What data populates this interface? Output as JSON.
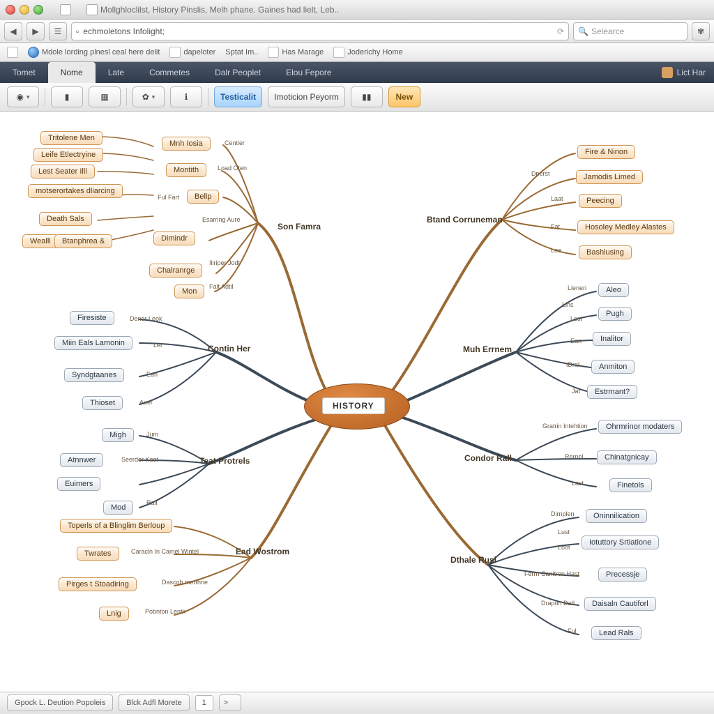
{
  "window": {
    "title": "Mollghloclilst, History Pinslis, Melh phane. Gaines had lielt, Leb.."
  },
  "browser": {
    "url": "echmoletons Infolight;",
    "search_placeholder": "Selearce",
    "bookmarks": [
      {
        "label": "Mdole lording plnesl ceal here delit"
      },
      {
        "label": "dapeloter"
      },
      {
        "label": "Sptat Im.."
      },
      {
        "label": "Has Marage"
      },
      {
        "label": "Joderichy Home"
      }
    ]
  },
  "appnav": {
    "items": [
      "Tomet",
      "Nome",
      "Late",
      "Commetes",
      "Dalr Peoplet",
      "Elou Fepore"
    ],
    "active": 1,
    "user": "Lict Har"
  },
  "toolbar": {
    "tab_blue": "Testicalit",
    "tab_plain": "Imoticion Peyorm",
    "tab_new": "New"
  },
  "center": "HISTORY",
  "branches": {
    "bl1": "Son Famra",
    "bl2": "Contin Her",
    "bl3": "Teat Protrels",
    "bl4": "Ead Wostrom",
    "br1": "Btand Corruneman",
    "br2": "Muh Errnem",
    "br3": "Condor Rall",
    "br4": "Dthale Rusl"
  },
  "nodes": {
    "tl_a": "Tritolene Men",
    "tl_b": "Leife Etlectryine",
    "tl_c": "Lest Seater Illl",
    "tl_d": "motserortakes dliarcing",
    "tl_e": "Death Sals",
    "tl_f": "Wealll",
    "tl_g": "Btanphrea &",
    "o1": "Mnh Iosia",
    "o2": "Montith",
    "o3": "Bellp",
    "o4": "Dimindr",
    "o5": "Chalranrge",
    "o6": "Mon",
    "g1": "Firesiste",
    "g2": "Miin Eals Lamonin",
    "g3": "Syndgtaanes",
    "g4": "Thioset",
    "g5": "Migh",
    "g6": "Atnnwer",
    "g7": "Euimers",
    "g8": "Mod",
    "o7": "Toperls of a Blinglim Berloup",
    "o8": "Twrates",
    "o9": "Pirges t Stoadiring",
    "o10": "Lnig",
    "r1": "Fire & Ninon",
    "r2": "Jamodis Limed",
    "r3": "Peecing",
    "r4": "Hosoley Medley Alastes",
    "r5": "Bashlusing",
    "rg1": "Aleo",
    "rg2": "Pugh",
    "rg3": "Inalitor",
    "rg4": "Anmiton",
    "rg5": "Estrmant?",
    "rg6": "Ohrmrinor modaters",
    "rg7": "Chinatgnicay",
    "rg8": "Finetols",
    "rg9": "Oninnilication",
    "rg10": "Iotuttory Srtiatione",
    "rg11": "Precessje",
    "rg12": "Daisaln Cautiforl",
    "rg13": "Lead Rals"
  },
  "mini": {
    "m1": "Centier",
    "m2": "Load Oten",
    "m3": "Ful  Fart",
    "m4": "Esarring  Aure",
    "m5": "Iliriper Jodt",
    "m6": "Falt  Adtil",
    "m7": "Denor Leok",
    "m8": "Let",
    "m9": "Ean",
    "m10": "Auel",
    "m11": "Jum",
    "m12": "Seerder Kaot",
    "m13": "Rall",
    "m14": "Caracln In Camel Wintel",
    "m15": "Dascob merthne",
    "m16": "Pobnton Lentk",
    "m17": "Dperst",
    "m18": "Laat",
    "m19": "Fat",
    "m20": "Lee",
    "m21": "Lienen",
    "m22": "Lihs",
    "m23": "Lest",
    "m24": "Ean",
    "m25": "tDral",
    "m26": "Jat",
    "m27": "Gratrin Intehtion",
    "m28": "Rernel",
    "m29": "Last",
    "m30": "Dirnplen",
    "m31": "Lust",
    "m32": "Loot",
    "m33": "Ferrn Canitron Hast",
    "m34": "Drapon Datl",
    "m35": "Ful"
  },
  "status": {
    "btn1": "Gpock L. Deution Popoleis",
    "btn2": "Blck Adfl Morete",
    "page": "1",
    "next": ">"
  }
}
